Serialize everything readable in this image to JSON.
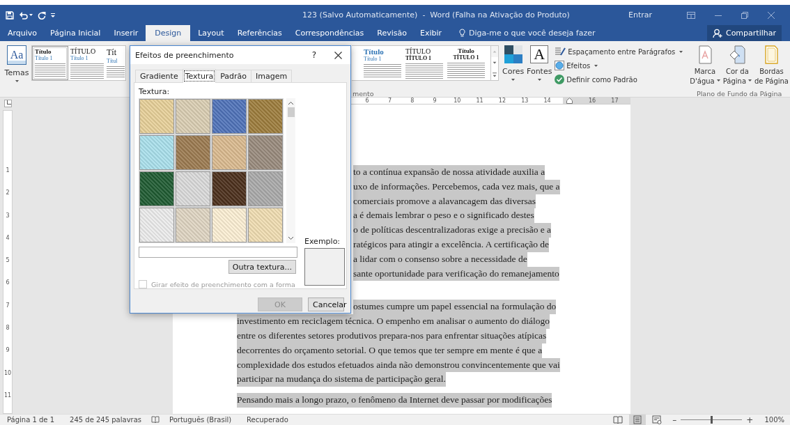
{
  "title_bar": {
    "title": "123 (Salvo Automaticamente)  -  Word (Falha na Ativação do Produto)",
    "sign_in": "Entrar"
  },
  "ribbon_tabs": [
    {
      "label": "Arquivo",
      "selected": false
    },
    {
      "label": "Página Inicial",
      "selected": false
    },
    {
      "label": "Inserir",
      "selected": false
    },
    {
      "label": "Design",
      "selected": true
    },
    {
      "label": "Layout",
      "selected": false
    },
    {
      "label": "Referências",
      "selected": false
    },
    {
      "label": "Correspondências",
      "selected": false
    },
    {
      "label": "Revisão",
      "selected": false
    },
    {
      "label": "Exibir",
      "selected": false
    }
  ],
  "tell_me": "Diga-me o que você deseja fazer",
  "share_button": "Compartilhar",
  "ribbon": {
    "themes": {
      "icon_text": "Aa",
      "label": "Temas"
    },
    "gallery_left": [
      {
        "heading": "Título",
        "subheading": "Título 1",
        "selected": true
      },
      {
        "heading": "TÍTULO",
        "subheading": "Título 1",
        "selected": false
      },
      {
        "heading": "Tít",
        "subheading": "Títul",
        "selected": false
      }
    ],
    "group_label_fragment": "mento",
    "gallery_right": [
      {
        "heading": "Título",
        "subheading": "Título 1"
      },
      {
        "heading": "TÍTULO",
        "subheading": "TÍTULO 1"
      },
      {
        "heading": "Título",
        "subheading": "TÍTULO 1"
      }
    ],
    "colors": {
      "label": "Cores"
    },
    "fonts": {
      "icon_text": "A",
      "label": "Fontes"
    },
    "paragraph_spacing": "Espaçamento entre Parágrafos",
    "effects": "Efeitos",
    "set_default": "Definir como Padrão",
    "page_background": {
      "buttons": [
        {
          "kind": "watermark",
          "lines": [
            "Marca",
            "D'água"
          ],
          "dropdown": true
        },
        {
          "kind": "page_color",
          "lines": [
            "Cor da",
            "Página"
          ],
          "dropdown": true
        },
        {
          "kind": "page_borders",
          "lines": [
            "Bordas",
            "de Página"
          ],
          "dropdown": false
        }
      ],
      "label": "Plano de Fundo da Página"
    }
  },
  "ruler": {
    "marks": [
      {
        "kind": "number",
        "label": "6"
      },
      {
        "kind": "number",
        "label": "7"
      },
      {
        "kind": "number",
        "label": "8"
      },
      {
        "kind": "number",
        "label": "9"
      },
      {
        "kind": "number",
        "label": "10"
      },
      {
        "kind": "number",
        "label": "11"
      },
      {
        "kind": "number",
        "label": "12"
      },
      {
        "kind": "number",
        "label": "13"
      },
      {
        "kind": "number",
        "label": "14"
      },
      {
        "kind": "indent"
      },
      {
        "kind": "number",
        "label": "16"
      },
      {
        "kind": "number",
        "label": "17"
      }
    ]
  },
  "vertical_ruler": [
    "1",
    "2",
    "3",
    "4",
    "5",
    "6",
    "7",
    "8",
    "9",
    "10",
    "11"
  ],
  "document": {
    "paragraphs": [
      {
        "lines": [
          "to a contínua expansão de nossa atividade auxilia a",
          "uxo de informações. Percebemos, cada vez mais, que a",
          "comerciais promove a alavancagem das diversas",
          "a é demais lembrar o peso e o significado destes",
          "o de políticas descentralizadoras exige a precisão e a",
          "ratégicos para atingir a excelência. A certificação de",
          "a lidar com o consenso sobre a necessidade de",
          "sante oportunidade para verificação do remanejamento"
        ]
      },
      {
        "lines": [
          "ostumes cumpre um papel essencial na formulação do",
          "investimento em reciclagem técnica. O empenho em analisar o aumento do diálogo",
          "entre os diferentes setores produtivos prepara-nos para enfrentar situações atípicas",
          "decorrentes do orçamento setorial. O que temos que ter sempre em mente é que a",
          "complexidade dos estudos efetuados ainda não demonstrou convincentemente que vai",
          "participar na mudança do sistema de participação geral."
        ]
      },
      {
        "lines": [
          "Pensando mais a longo prazo, o fenômeno da Internet deve passar por modificações"
        ]
      }
    ]
  },
  "dialog": {
    "title": "Efeitos de preenchimento",
    "help": "?",
    "tabs": [
      {
        "label": "Gradiente",
        "selected": false
      },
      {
        "label": "Textura",
        "selected": true
      },
      {
        "label": "Padrão",
        "selected": false
      },
      {
        "label": "Imagem",
        "selected": false
      }
    ],
    "texture_label": "Textura:",
    "textures": [
      {
        "color": "#e6cf98"
      },
      {
        "color": "#d9cdb2"
      },
      {
        "color": "#4f72b8"
      },
      {
        "color": "#9c7c3c"
      },
      {
        "color": "#a9dfeb"
      },
      {
        "color": "#9b7a50"
      },
      {
        "color": "#d9b98e"
      },
      {
        "color": "#988a7c"
      },
      {
        "color": "#1f5b32"
      },
      {
        "color": "#d9d9d9"
      },
      {
        "color": "#4b2f1b"
      },
      {
        "color": "#a9a9a9"
      },
      {
        "color": "#ebebeb"
      },
      {
        "color": "#ded4c1"
      },
      {
        "color": "#fbeed3"
      },
      {
        "color": "#efdcb1"
      }
    ],
    "other_texture_button": "Outra textura...",
    "rotate_checkbox": {
      "label": "Girar efeito de preenchimento com a forma",
      "checked": false,
      "disabled": true
    },
    "example_label": "Exemplo:",
    "buttons": [
      {
        "label": "OK",
        "disabled": true
      },
      {
        "label": "Cancelar",
        "disabled": false
      }
    ]
  },
  "status_bar": {
    "page": "Página 1 de 1",
    "words": "245 de 245 palavras",
    "language": "Português (Brasil)",
    "state": "Recuperado",
    "views": [
      {
        "kind": "read",
        "selected": false
      },
      {
        "kind": "print",
        "selected": true
      },
      {
        "kind": "web",
        "selected": false
      }
    ],
    "zoom_out": "–",
    "zoom": {
      "level": 0.5
    },
    "zoom_in": "+",
    "zoom_percent": "100%"
  }
}
